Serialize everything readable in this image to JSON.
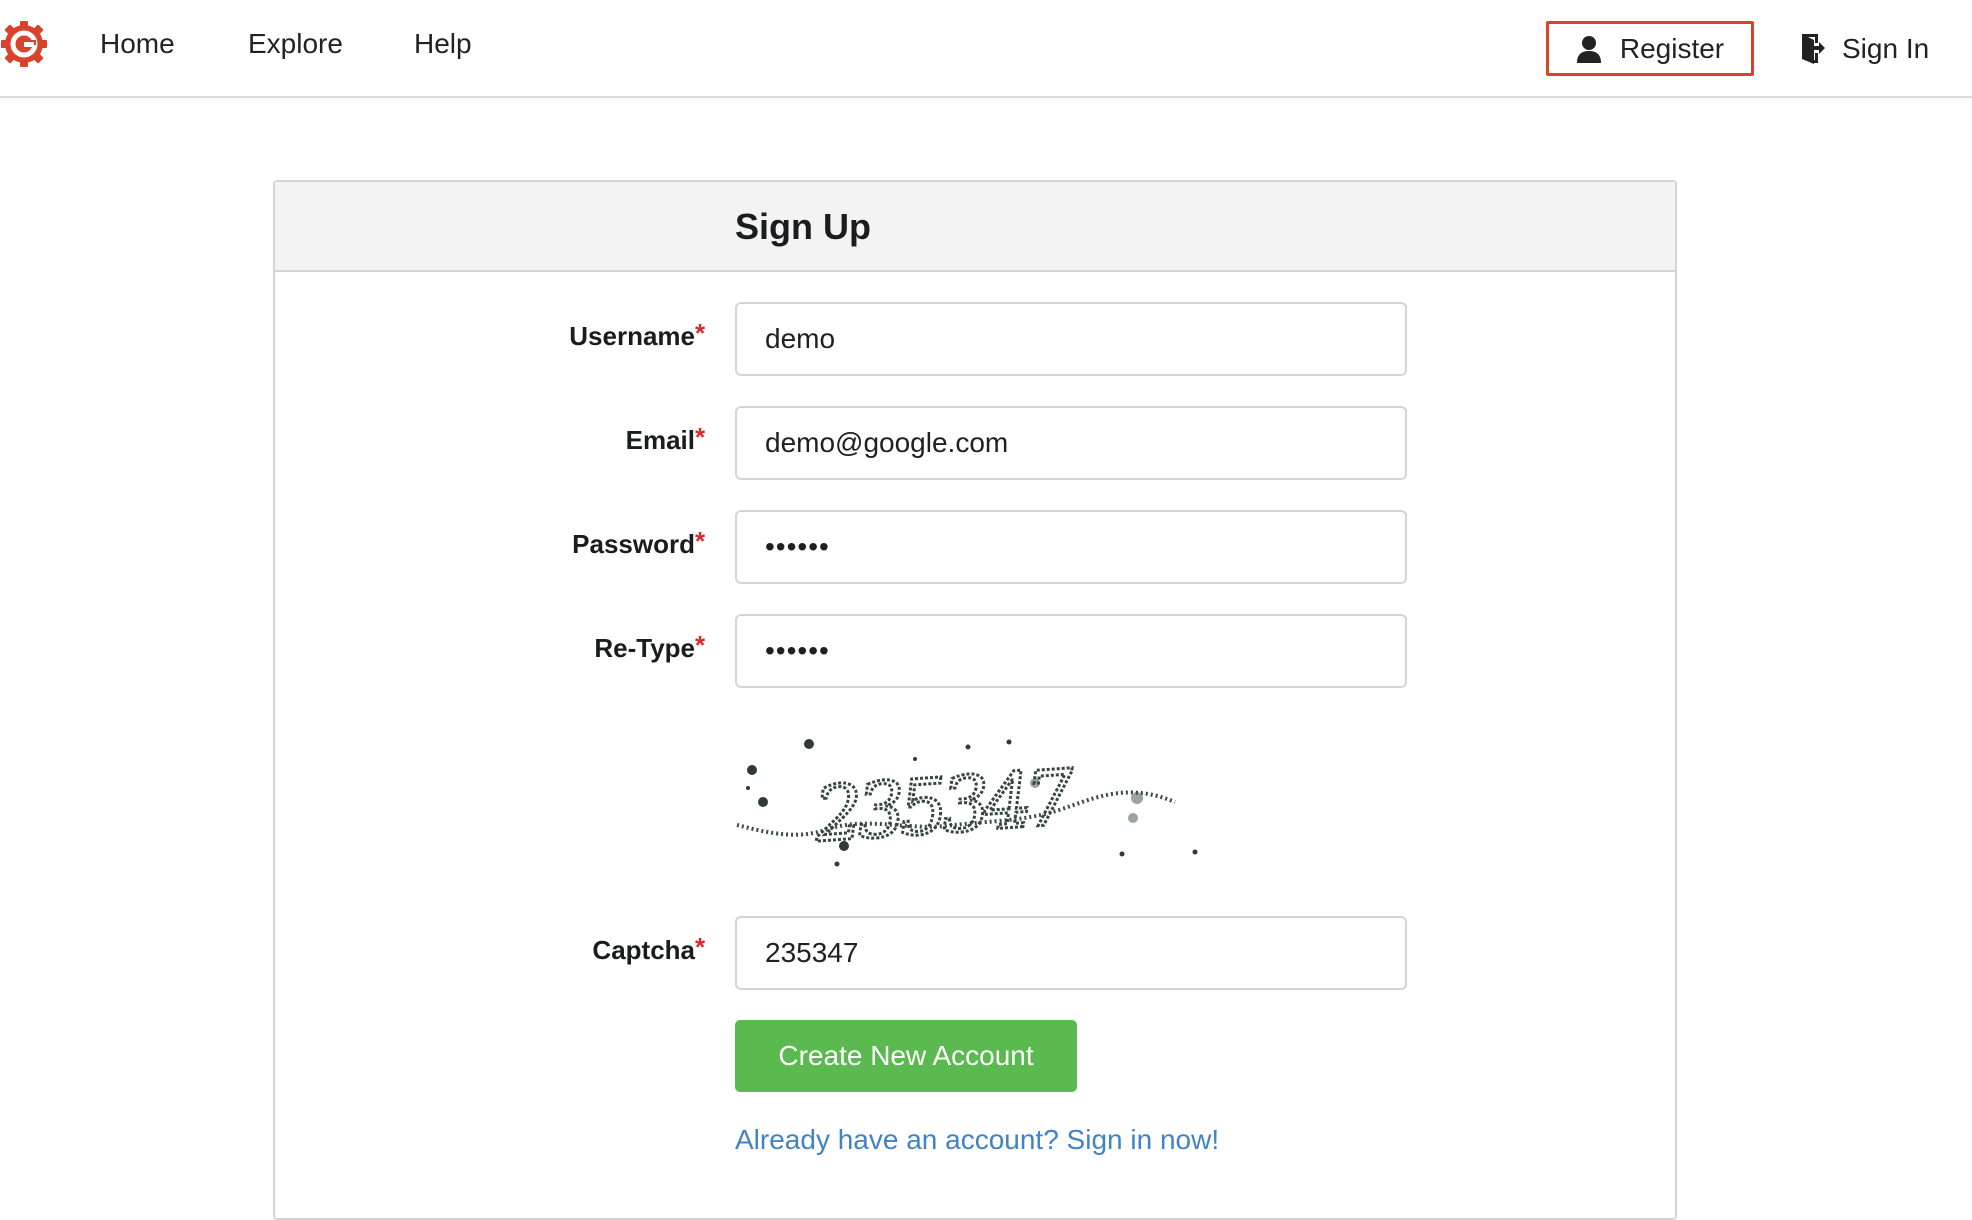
{
  "nav": {
    "home_label": "Home",
    "explore_label": "Explore",
    "help_label": "Help",
    "register_label": "Register",
    "sign_in_label": "Sign In"
  },
  "colors": {
    "brand": "#d9432c",
    "primary_button": "#5ab94f",
    "link": "#4183c4",
    "required_marker": "#db2828"
  },
  "form": {
    "title": "Sign Up",
    "required_marker": "*",
    "fields": {
      "username": {
        "label": "Username",
        "value": "demo"
      },
      "email": {
        "label": "Email",
        "value": "demo@google.com"
      },
      "password": {
        "label": "Password",
        "value": "••••••"
      },
      "retype": {
        "label": "Re-Type",
        "value": "••••••"
      },
      "captcha": {
        "label": "Captcha",
        "value": "235347"
      }
    },
    "captcha_image_text": "235347",
    "submit_label": "Create New Account",
    "sign_in_prompt": "Already have an account? Sign in now!"
  }
}
